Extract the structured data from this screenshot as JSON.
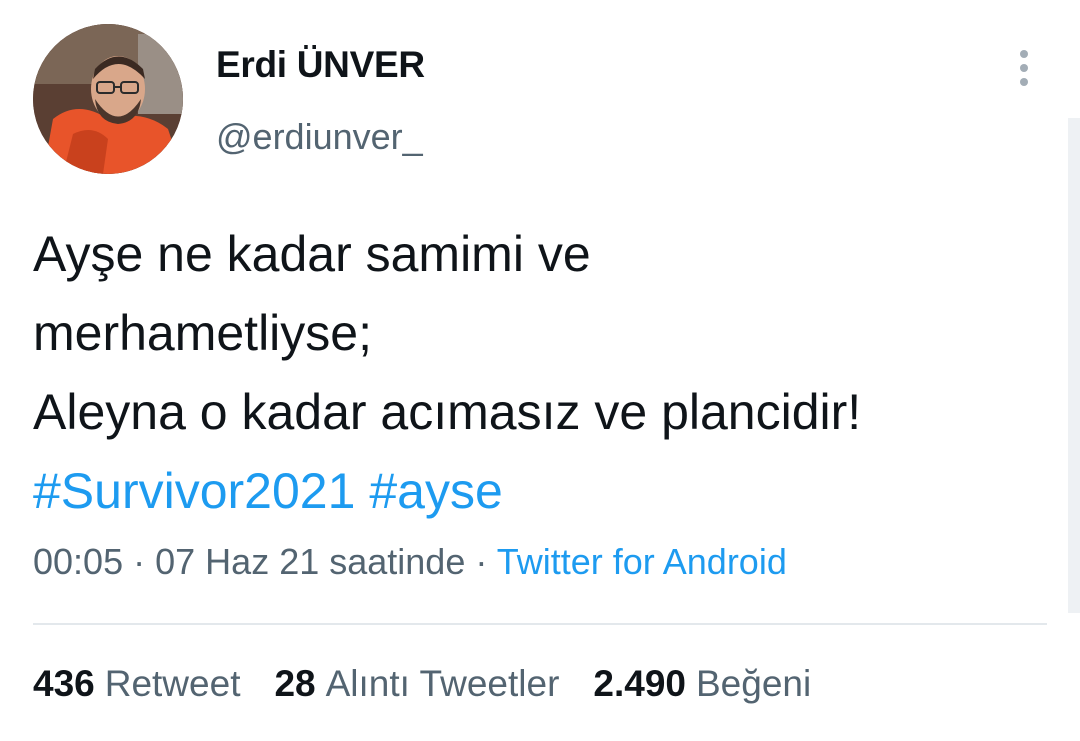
{
  "author": {
    "display_name": "Erdi ÜNVER",
    "handle": "@erdiunver_",
    "avatar_icon": "profile-photo"
  },
  "more_icon": "more-vertical-icon",
  "tweet": {
    "lines": [
      "Ayşe ne kadar samimi ve",
      "merhametliyse;",
      "Aleyna o kadar acımasız ve plancidir!"
    ],
    "hashtags": [
      "#Survivor2021",
      "#ayse"
    ]
  },
  "meta": {
    "time": "00:05",
    "date": "07 Haz 21 saatinde",
    "separator": "·",
    "source": "Twitter for Android"
  },
  "stats": [
    {
      "count": "436",
      "label": "Retweet"
    },
    {
      "count": "28",
      "label": "Alıntı Tweetler"
    },
    {
      "count": "2.490",
      "label": "Beğeni"
    }
  ],
  "colors": {
    "link": "#1d9bf0",
    "secondary_text": "#536471",
    "primary_text": "#0f1419"
  }
}
